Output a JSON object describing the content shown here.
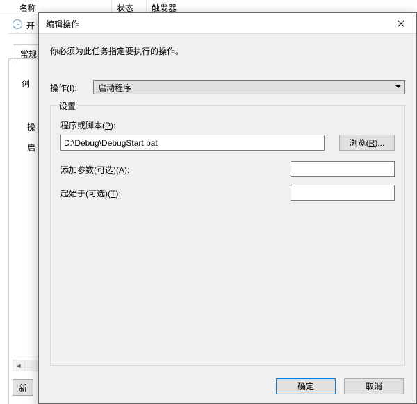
{
  "bg": {
    "col_name": "名称",
    "col_state": "状态",
    "col_trigger": "触发器",
    "title_prefix": "开",
    "tab_general": "常规",
    "label_create": "创",
    "label_op": "操",
    "label_start": "启",
    "button_new": "新"
  },
  "dialog": {
    "title": "编辑操作",
    "instruction": "你必须为此任务指定要执行的操作。",
    "action_label": "操作(I):",
    "action_value": "启动程序",
    "settings_legend": "设置",
    "program_label": "程序或脚本(P):",
    "program_value": "D:\\Debug\\DebugStart.bat",
    "browse": "浏览(R)...",
    "args_label": "添加参数(可选)(A):",
    "args_value": "",
    "startin_label": "起始于(可选)(T):",
    "startin_value": "",
    "ok": "确定",
    "cancel": "取消"
  }
}
